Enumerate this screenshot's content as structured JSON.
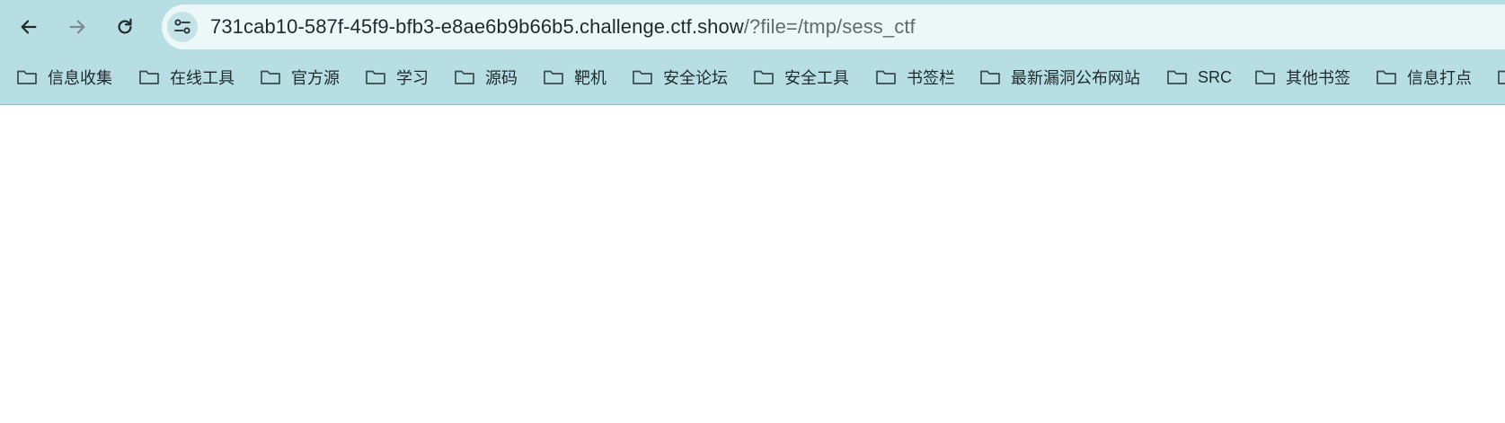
{
  "browser": {
    "url_host": "731cab10-587f-45f9-bfb3-e8ae6b9b66b5.challenge.ctf.show",
    "url_rest": "/?file=/tmp/sess_ctf"
  },
  "bookmarks": [
    "信息收集",
    "在线工具",
    "官方源",
    "学习",
    "源码",
    "靶机",
    "安全论坛",
    "安全工具",
    "书签栏",
    "最新漏洞公布网站",
    "SRC",
    "其他书签",
    "信息打点"
  ],
  "colors": {
    "toolbar_bg": "#b7dfe3",
    "omnibox_bg": "#ecf7f8",
    "page_bg": "#ffffff"
  },
  "icons": {
    "back": "arrow-left-icon",
    "forward": "arrow-right-icon",
    "reload": "reload-icon",
    "site_info": "tune-icon",
    "bookmark_folder": "folder-icon"
  }
}
